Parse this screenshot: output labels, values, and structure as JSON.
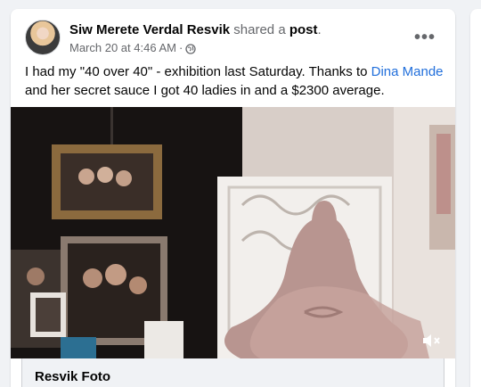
{
  "post": {
    "author": "Siw Merete Verdal Resvik",
    "action": "shared a",
    "object": "post",
    "period": ".",
    "timestamp": "March 20 at 4:46 AM",
    "separator": "·",
    "privacy_icon": "globe-icon",
    "more_icon": "more-horizontal-icon",
    "more_label": "•••",
    "text_before": "I had my \"40 over 40\" - exhibition last Saturday. Thanks to ",
    "mention": "Dina Mande",
    "text_after": " and her secret sauce I got 40 ladies in and a $2300 average.",
    "video_mute_icon": "volume-muted-icon",
    "link_title": "Resvik Foto"
  },
  "colors": {
    "page_bg": "#f0f2f5",
    "card_bg": "#ffffff",
    "text_primary": "#050505",
    "text_secondary": "#65676b",
    "link": "#216fdb"
  }
}
